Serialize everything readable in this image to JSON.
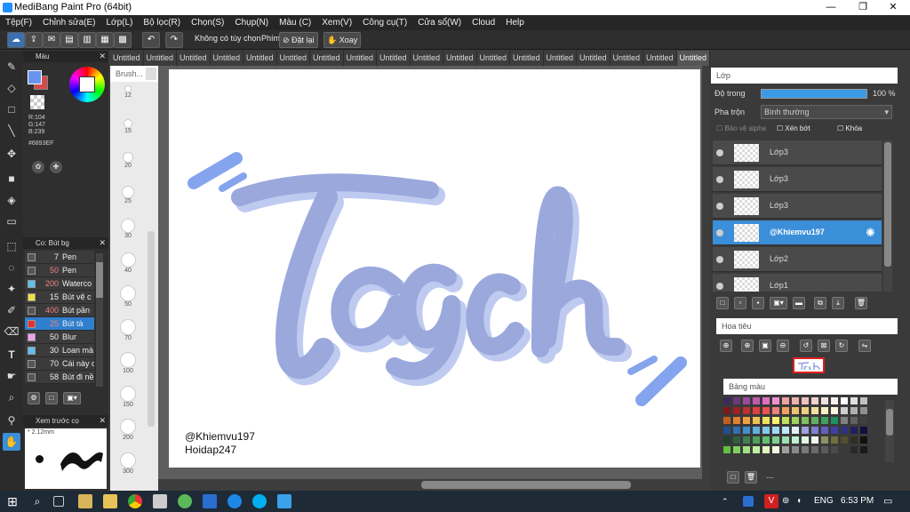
{
  "window": {
    "title": "MediBang Paint Pro (64bit)",
    "controls": [
      "—",
      "❐",
      "✕"
    ]
  },
  "menu": [
    "Tệp(F)",
    "Chỉnh sửa(E)",
    "Lớp(L)",
    "Bộ lọc(R)",
    "Chọn(S)",
    "Chụp(N)",
    "Màu (C)",
    "Xem(V)",
    "Công cụ(T)",
    "Cửa sổ(W)",
    "Cloud",
    "Help"
  ],
  "toolbar": {
    "no_option": "Không có tùy chọn",
    "key_label": "Phím",
    "reset_label": "Đặt lại",
    "rotate_label": "Xoay"
  },
  "tabs": [
    "Untitled",
    "Untitled",
    "Untitled",
    "Untitled",
    "Untitled",
    "Untitled",
    "Untitled",
    "Untitled",
    "Untitled",
    "Untitled",
    "Untitled",
    "Untitled",
    "Untitled",
    "Untitled",
    "Untitled",
    "Untitled",
    "Untitled",
    "Untitled"
  ],
  "color_panel": {
    "title": "Màu",
    "r": "R:104",
    "g": "G:147",
    "b": "B:239",
    "hex": "#6893EF",
    "fg": "#6893ef",
    "bg": "#d44a4a"
  },
  "brush_panel": {
    "title": "Brush...",
    "sizes": [
      "12",
      "15",
      "20",
      "25",
      "30",
      "40",
      "50",
      "70",
      "100",
      "150",
      "200",
      "300"
    ]
  },
  "brush_list": {
    "title": "Co: Bút bg",
    "items": [
      {
        "size": "7",
        "name": "Pen",
        "color": "#555555"
      },
      {
        "size": "50",
        "name": "Pen",
        "color": "#555555"
      },
      {
        "size": "200",
        "name": "Waterco",
        "color": "#5bc0f0"
      },
      {
        "size": "15",
        "name": "Bút vẽ c",
        "color": "#f0e040"
      },
      {
        "size": "400",
        "name": "Bút pần",
        "color": "#555555"
      },
      {
        "size": "25",
        "name": "Bút tà",
        "color": "#e83030"
      },
      {
        "size": "50",
        "name": "Blur",
        "color": "#f0a0f0"
      },
      {
        "size": "30",
        "name": "Loan mà",
        "color": "#5bc0f0"
      },
      {
        "size": "70",
        "name": "Cái này c",
        "color": "#555555"
      },
      {
        "size": "58",
        "name": "Bút đi nề",
        "color": "#555555"
      }
    ]
  },
  "preview": {
    "title": "Xem trước cọ",
    "size": "2.12mm"
  },
  "canvas": {
    "line1": "@Khiemvu197",
    "line2": "Hoidap247",
    "art_fill": "#9aa8dc",
    "art_shadow": "#bfcaf0"
  },
  "layer_panel": {
    "title": "Lớp",
    "opacity_label": "Độ trong",
    "opacity_value": "100 %",
    "opacity_fraction": 1.0,
    "blend_label": "Pha trộn",
    "blend_value": "Bình thường",
    "protect_alpha": "Bảo vệ alpha",
    "clipping": "Xén bớt",
    "lock": "Khóa",
    "layers": [
      {
        "name": "Lớp3",
        "selected": false
      },
      {
        "name": "Lớp3",
        "selected": false
      },
      {
        "name": "Lớp3",
        "selected": false
      },
      {
        "name": "@Khiemvu197",
        "selected": true
      },
      {
        "name": "Lớp2",
        "selected": false
      },
      {
        "name": "Lớp1",
        "selected": false
      }
    ]
  },
  "navigator": {
    "title": "Hoa tiêu"
  },
  "palette": {
    "title": "Bảng màu",
    "footer": "---"
  },
  "taskbar": {
    "lang": "ENG",
    "time": "6:53 PM"
  }
}
